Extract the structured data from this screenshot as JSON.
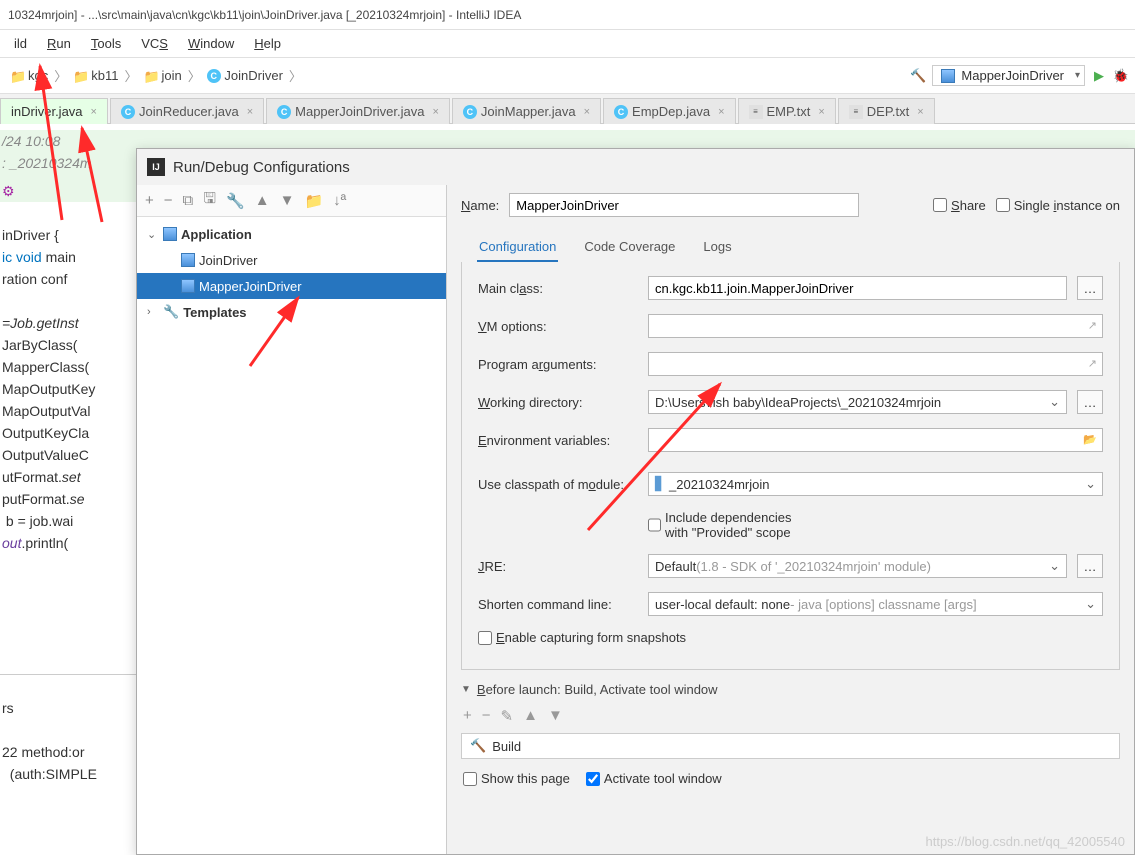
{
  "title": "10324mrjoin] - ...\\src\\main\\java\\cn\\kgc\\kb11\\join\\JoinDriver.java [_20210324mrjoin] - IntelliJ IDEA",
  "menu": {
    "run": "Run",
    "tools": "Tools",
    "vcs": "VCS",
    "window": "Window",
    "help": "Help",
    "ild": "ild"
  },
  "breadcrumb": {
    "p1": "kgc",
    "p2": "kb11",
    "p3": "join",
    "p4": "JoinDriver"
  },
  "run_selector": "MapperJoinDriver",
  "tabs": {
    "t0": "inDriver.java",
    "t1": "JoinReducer.java",
    "t2": "MapperJoinDriver.java",
    "t3": "JoinMapper.java",
    "t4": "EmpDep.java",
    "t5": "EMP.txt",
    "t6": "DEP.txt"
  },
  "editor": {
    "l1": "/24 10:08",
    "l2": ": _20210324m",
    "l3": "inDriver {",
    "l4a": "ic void",
    "l4b": " main",
    "l5": "ration conf ",
    "l6": "=Job.getInst",
    "l7": "JarByClass( ",
    "l8": "MapperClass(",
    "l9": "MapOutputKey",
    "l10": "MapOutputVal",
    "l11": "OutputKeyCla",
    "l12": "OutputValueC",
    "l13a": "utFormat.",
    "l13b": "set",
    "l14a": "putFormat.",
    "l14b": "se",
    "l15": " b = job.wai",
    "l16a": "out",
    "l16b": ".println(",
    "l17": "rs",
    "l18": "22 method:or",
    "l19": "  (auth:SIMPLE"
  },
  "dlg": {
    "title": "Run/Debug Configurations",
    "name_label": "Name:",
    "name_value": "MapperJoinDriver",
    "share": "Share",
    "single": "Single instance on",
    "tree": {
      "app": "Application",
      "n1": "JoinDriver",
      "n2": "MapperJoinDriver",
      "tpl": "Templates"
    },
    "tabs": {
      "cfg": "Configuration",
      "cov": "Code Coverage",
      "logs": "Logs"
    },
    "form": {
      "main_class": "Main class:",
      "main_class_v": "cn.kgc.kb11.join.MapperJoinDriver",
      "vm": "VM options:",
      "prog": "Program arguments:",
      "wdir": "Working directory:",
      "wdir_v": "D:\\Users\\fish baby\\IdeaProjects\\_20210324mrjoin",
      "env": "Environment variables:",
      "module": "Use classpath of module:",
      "module_v": "_20210324mrjoin",
      "provided": "Include dependencies with \"Provided\" scope",
      "jre": "JRE:",
      "jre_v1": "Default ",
      "jre_v2": "(1.8 - SDK of '_20210324mrjoin' module)",
      "shorten": "Shorten command line:",
      "shorten_v1": "user-local default: none",
      "shorten_v2": " - java [options] classname [args]",
      "snapshots": "Enable capturing form snapshots",
      "before": "Before launch: Build, Activate tool window",
      "build": "Build",
      "show": "Show this page",
      "activate": "Activate tool window"
    }
  },
  "watermark": "https://blog.csdn.net/qq_42005540"
}
